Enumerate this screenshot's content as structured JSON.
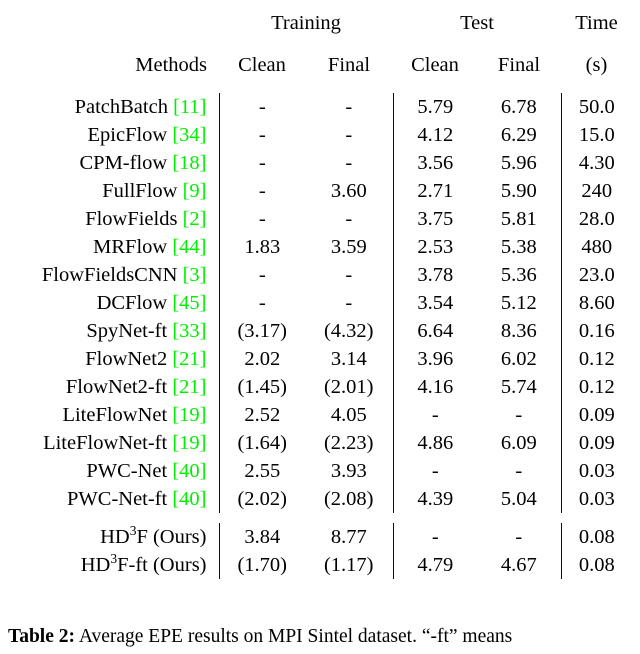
{
  "table": {
    "number_label": "Table 2:",
    "caption_text": "Average EPE results on MPI Sintel dataset. “-ft” means",
    "group_headers": {
      "blank": "",
      "training": "Training",
      "test": "Test",
      "time": "Time"
    },
    "column_headers": {
      "methods": "Methods",
      "train_clean": "Clean",
      "train_final": "Final",
      "test_clean": "Clean",
      "test_final": "Final",
      "time": "(s)"
    },
    "rows": [
      {
        "method_name": "PatchBatch",
        "citation": "[11]",
        "train_clean": "-",
        "train_final": "-",
        "test_clean": "5.79",
        "test_final": "6.78",
        "time": "50.0"
      },
      {
        "method_name": "EpicFlow",
        "citation": "[34]",
        "train_clean": "-",
        "train_final": "-",
        "test_clean": "4.12",
        "test_final": "6.29",
        "time": "15.0"
      },
      {
        "method_name": "CPM-flow",
        "citation": "[18]",
        "train_clean": "-",
        "train_final": "-",
        "test_clean": "3.56",
        "test_final": "5.96",
        "time": "4.30"
      },
      {
        "method_name": "FullFlow",
        "citation": "[9]",
        "train_clean": "-",
        "train_final": "3.60",
        "test_clean": "2.71",
        "test_final": "5.90",
        "time": "240"
      },
      {
        "method_name": "FlowFields",
        "citation": "[2]",
        "train_clean": "-",
        "train_final": "-",
        "test_clean": "3.75",
        "test_final": "5.81",
        "time": "28.0"
      },
      {
        "method_name": "MRFlow",
        "citation": "[44]",
        "train_clean": "1.83",
        "train_final": "3.59",
        "test_clean": "2.53",
        "test_final": "5.38",
        "time": "480"
      },
      {
        "method_name": "FlowFieldsCNN",
        "citation": "[3]",
        "train_clean": "-",
        "train_final": "-",
        "test_clean": "3.78",
        "test_final": "5.36",
        "time": "23.0"
      },
      {
        "method_name": "DCFlow",
        "citation": "[45]",
        "train_clean": "-",
        "train_final": "-",
        "test_clean": "3.54",
        "test_final": "5.12",
        "time": "8.60"
      },
      {
        "method_name": "SpyNet-ft",
        "citation": "[33]",
        "train_clean": "(3.17)",
        "train_final": "(4.32)",
        "test_clean": "6.64",
        "test_final": "8.36",
        "time": "0.16"
      },
      {
        "method_name": "FlowNet2",
        "citation": "[21]",
        "train_clean": "2.02",
        "train_final": "3.14",
        "test_clean": "3.96",
        "test_final": "6.02",
        "time": "0.12"
      },
      {
        "method_name": "FlowNet2-ft",
        "citation": "[21]",
        "train_clean": "(1.45)",
        "train_final": "(2.01)",
        "test_clean": "4.16",
        "test_final": "5.74",
        "time": "0.12"
      },
      {
        "method_name": "LiteFlowNet",
        "citation": "[19]",
        "train_clean": "2.52",
        "train_final": "4.05",
        "test_clean": "-",
        "test_final": "-",
        "time": "0.09"
      },
      {
        "method_name": "LiteFlowNet-ft",
        "citation": "[19]",
        "train_clean": "(1.64)",
        "train_final": "(2.23)",
        "test_clean": "4.86",
        "test_final": "6.09",
        "time": "0.09"
      },
      {
        "method_name": "PWC-Net",
        "citation": "[40]",
        "train_clean": "2.55",
        "train_final": "3.93",
        "test_clean": "-",
        "test_final": "-",
        "time": "0.03"
      },
      {
        "method_name": "PWC-Net-ft",
        "citation": "[40]",
        "train_clean": "(2.02)",
        "train_final": "(2.08)",
        "test_clean": "4.39",
        "test_final": "5.04",
        "time": "0.03"
      }
    ],
    "ours_rows": [
      {
        "method_prefix": "HD",
        "method_superscript": "3",
        "method_suffix": "F (Ours)",
        "train_clean": "3.84",
        "train_final": "8.77",
        "test_clean": "-",
        "test_final": "-",
        "time": "0.08"
      },
      {
        "method_prefix": "HD",
        "method_superscript": "3",
        "method_suffix": "F-ft (Ours)",
        "train_clean": "(1.70)",
        "train_final": "(1.17)",
        "test_clean": "4.79",
        "test_final": "4.67",
        "time": "0.08"
      }
    ],
    "bold_cells": [
      "3.test_clean",
      "10.train_clean",
      "13.time",
      "14.time",
      "ours.1.train_final",
      "ours.1.test_final"
    ],
    "colors": {
      "citation_green": "#00ee00",
      "text": "#000000",
      "rule": "#111111",
      "background": "#ffffff"
    }
  }
}
